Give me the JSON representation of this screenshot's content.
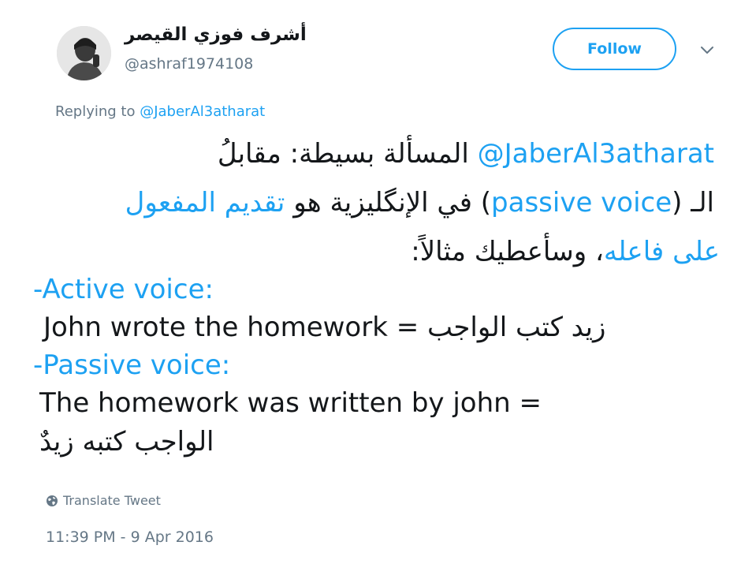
{
  "author": {
    "display_name": "أشرف فوزي القيصر",
    "handle": "@ashraf1974108"
  },
  "follow_button": {
    "label": "Follow"
  },
  "menu": {
    "icon": "chevron-down-icon"
  },
  "reply": {
    "prefix": "Replying to ",
    "mention": "@JaberAl3atharat"
  },
  "body": {
    "line1_mention": "@JaberAl3atharat",
    "line1_text": "المسألة بسيطة: مقابلُ",
    "line2_a": "الـ (",
    "line2_link": "passive voice",
    "line2_b": ") في الإنگليزية هو ",
    "line2_c": "تقديم المفعول",
    "line3_link": "على فاعله",
    "line3_text": "، وسأعطيك مثالاً:",
    "line4": "-Active voice:",
    "line5": "John wrote the homework = زيد كتب الواجب",
    "line6": "-Passive voice:",
    "line7": "The homework was written by john =",
    "line8": "الواجب كتبه زيدٌ"
  },
  "translate": {
    "icon": "globe-icon",
    "label": "Translate Tweet"
  },
  "timestamp": "11:39 PM - 9 Apr 2016",
  "colors": {
    "accent": "#1da1f2",
    "text": "#14171a",
    "muted": "#657786"
  }
}
